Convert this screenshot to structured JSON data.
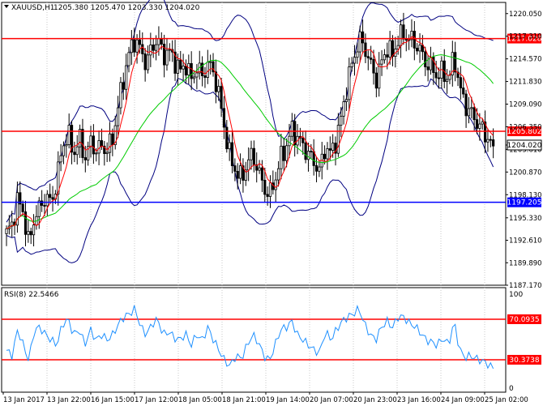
{
  "header": {
    "symbol_label": "XAUUSD,H1",
    "ohlc_label": "1205.380 1205.470 1203.330 1204.020"
  },
  "colors": {
    "background": "#ffffff",
    "bull_candle": "#000000",
    "bear_candle": "#000000",
    "bollinger": "#000080",
    "ma_fast": "#ff0000",
    "ma_slow": "#00cc00",
    "level_red": "#ff0000",
    "level_blue": "#0000ff",
    "rsi_line": "#1e90ff",
    "grid": "#c8c8c8",
    "axis_text": "#000000"
  },
  "price_axis_ticks": [
    "1220.050",
    "1217.310",
    "1214.570",
    "1211.830",
    "1209.090",
    "1206.350",
    "1203.610",
    "1200.870",
    "1198.130",
    "1195.330",
    "1192.610",
    "1189.890",
    "1187.170"
  ],
  "levels": [
    {
      "label": "1217.028",
      "value": 1217.028,
      "color": "red"
    },
    {
      "label": "1205.802",
      "value": 1205.802,
      "color": "red"
    },
    {
      "label": "1197.205",
      "value": 1197.205,
      "color": "blue"
    }
  ],
  "current_price": {
    "label": "1204.020",
    "value": 1204.02
  },
  "rsi": {
    "label": "RSI(8) 22.5466",
    "current": 22.5466,
    "axis_ticks": [
      "100",
      "0"
    ],
    "levels": [
      {
        "label": "70.0935",
        "value": 70.0935
      },
      {
        "label": "30.3738",
        "value": 30.3738
      }
    ]
  },
  "time_axis": [
    "13 Jan 2017",
    "13 Jan 22:00",
    "16 Jan 15:00",
    "17 Jan 12:00",
    "18 Jan 05:00",
    "18 Jan 21:00",
    "19 Jan 14:00",
    "20 Jan 07:00",
    "20 Jan 23:00",
    "23 Jan 16:00",
    "24 Jan 09:00",
    "25 Jan 02:00"
  ],
  "chart_data": {
    "type": "candlestick",
    "symbol": "XAUUSD",
    "timeframe": "H1",
    "ylim": [
      1187.17,
      1221.4
    ],
    "close_anchors": [
      1193.5,
      1194.5,
      1197.5,
      1196,
      1192,
      1195.5,
      1196.5,
      1198,
      1197,
      1200,
      1204,
      1205.5,
      1203,
      1205,
      1202.5,
      1204.5,
      1203.5,
      1204,
      1203.5,
      1205,
      1209,
      1212.5,
      1215.5,
      1217,
      1215.5,
      1214,
      1216,
      1217,
      1215,
      1215.5,
      1214.5,
      1213,
      1214,
      1212,
      1213.5,
      1212.5,
      1214,
      1213,
      1210,
      1206,
      1202.5,
      1201,
      1200,
      1202,
      1203,
      1201,
      1199,
      1198,
      1200,
      1202.5,
      1204,
      1206,
      1205,
      1204,
      1203,
      1202,
      1201,
      1204,
      1203,
      1205,
      1208,
      1212,
      1214.5,
      1217,
      1216,
      1214,
      1212,
      1214,
      1216,
      1215,
      1217,
      1217.5,
      1217,
      1216.5,
      1215.5,
      1214,
      1213.5,
      1212.5,
      1213,
      1212,
      1215,
      1211,
      1209,
      1208,
      1207,
      1206,
      1205,
      1204.02
    ],
    "series": [
      {
        "name": "RSI(8)",
        "type": "line",
        "values": [
          40,
          35,
          60,
          45,
          30,
          60,
          62,
          55,
          50,
          45,
          65,
          70,
          55,
          60,
          45,
          60,
          50,
          55,
          50,
          55,
          65,
          72,
          75,
          80,
          62,
          55,
          65,
          70,
          55,
          58,
          52,
          50,
          56,
          45,
          55,
          50,
          62,
          50,
          40,
          30,
          25,
          35,
          32,
          45,
          55,
          48,
          35,
          30,
          45,
          60,
          62,
          68,
          55,
          50,
          45,
          40,
          38,
          58,
          50,
          60,
          68,
          72,
          75,
          80,
          65,
          55,
          50,
          62,
          68,
          62,
          72,
          72,
          66,
          63,
          57,
          50,
          48,
          45,
          52,
          45,
          68,
          40,
          33,
          35,
          32,
          30,
          27,
          22.5466
        ]
      }
    ]
  }
}
